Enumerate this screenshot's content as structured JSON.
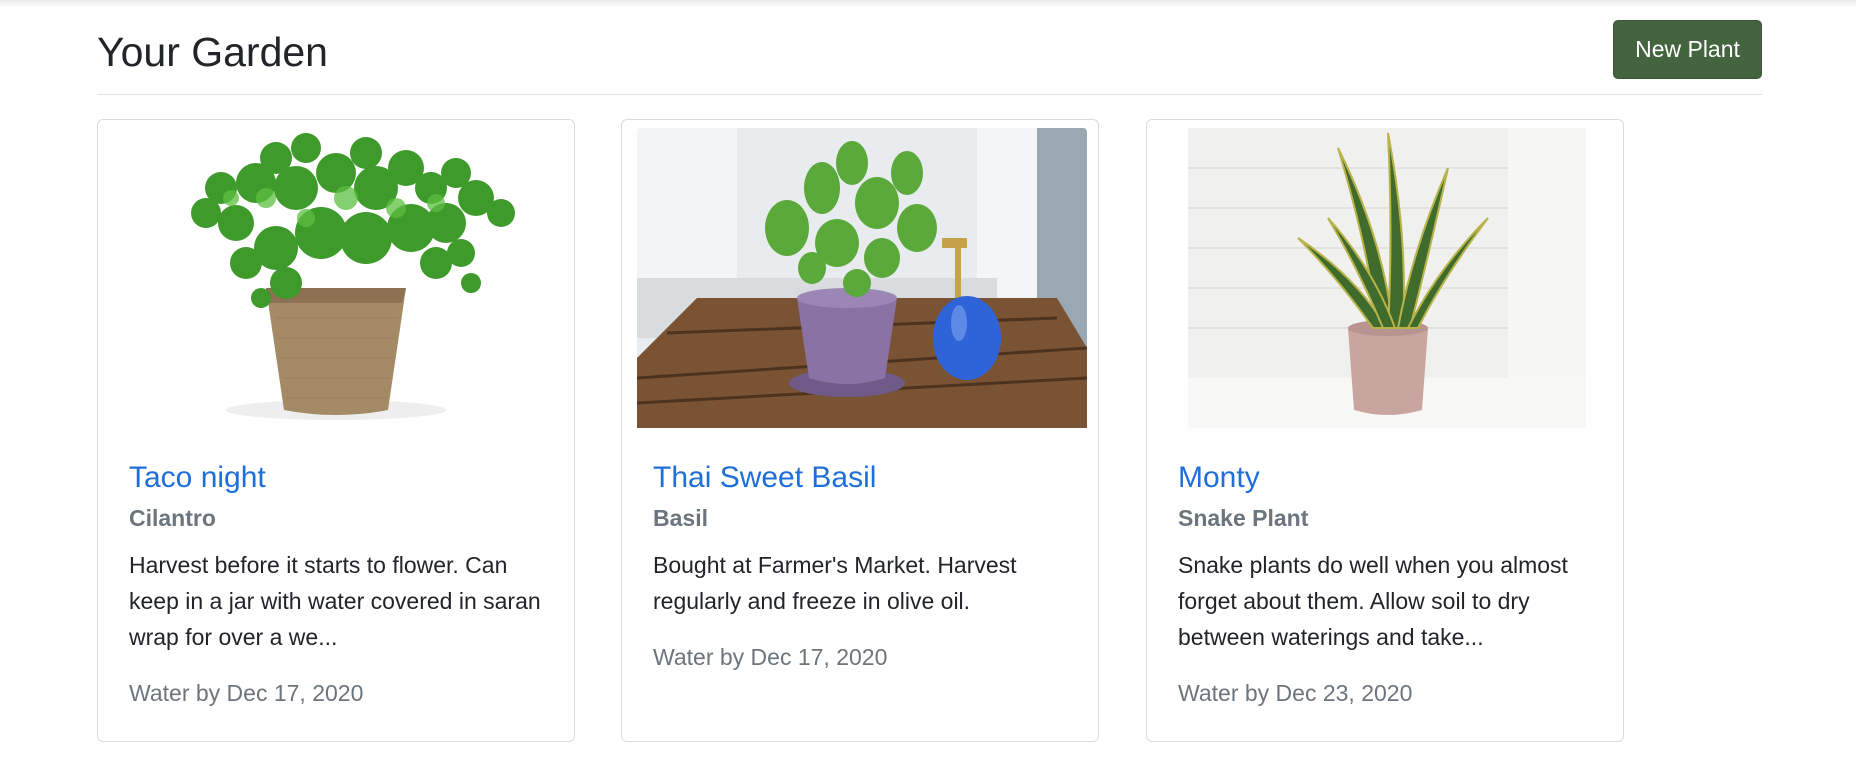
{
  "header": {
    "title": "Your Garden",
    "new_plant_label": "New Plant"
  },
  "colors": {
    "primary_button": "#44643f",
    "title_link": "#1e6fd9",
    "muted_text": "#6c757d"
  },
  "plants": [
    {
      "name": "Taco night",
      "species": "Cilantro",
      "notes": "Harvest before it starts to flower. Can keep in a jar with water covered in saran wrap for over a we...",
      "water_by": "Water by Dec 17, 2020",
      "image": "cilantro-in-burlap-pot"
    },
    {
      "name": "Thai Sweet Basil",
      "species": "Basil",
      "notes": "Bought at Farmer's Market. Harvest regularly and freeze in olive oil.",
      "water_by": "Water by Dec 17, 2020",
      "image": "basil-in-purple-pot-on-crate"
    },
    {
      "name": "Monty",
      "species": "Snake Plant",
      "notes": "Snake plants do well when you almost forget about them. Allow soil to dry between waterings and take...",
      "water_by": "Water by Dec 23, 2020",
      "image": "snake-plant-in-pink-pot"
    }
  ]
}
